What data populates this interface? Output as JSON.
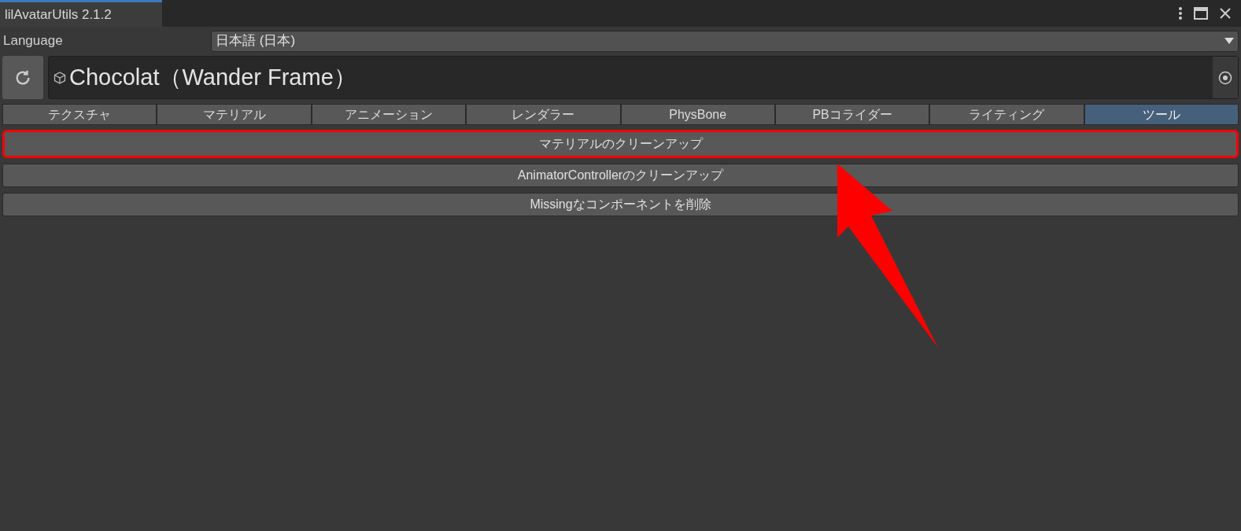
{
  "window": {
    "title": "lilAvatarUtils 2.1.2"
  },
  "language": {
    "label": "Language",
    "value": "日本語 (日本)"
  },
  "object": {
    "name": "Chocolat（Wander Frame）"
  },
  "tabs": [
    {
      "label": "テクスチャ",
      "selected": false
    },
    {
      "label": "マテリアル",
      "selected": false
    },
    {
      "label": "アニメーション",
      "selected": false
    },
    {
      "label": "レンダラー",
      "selected": false
    },
    {
      "label": "PhysBone",
      "selected": false
    },
    {
      "label": "PBコライダー",
      "selected": false
    },
    {
      "label": "ライティング",
      "selected": false
    },
    {
      "label": "ツール",
      "selected": true
    }
  ],
  "tools": [
    {
      "label": "マテリアルのクリーンアップ",
      "highlighted": true
    },
    {
      "label": "AnimatorControllerのクリーンアップ",
      "highlighted": false
    },
    {
      "label": "Missingなコンポーネントを削除",
      "highlighted": false
    }
  ]
}
